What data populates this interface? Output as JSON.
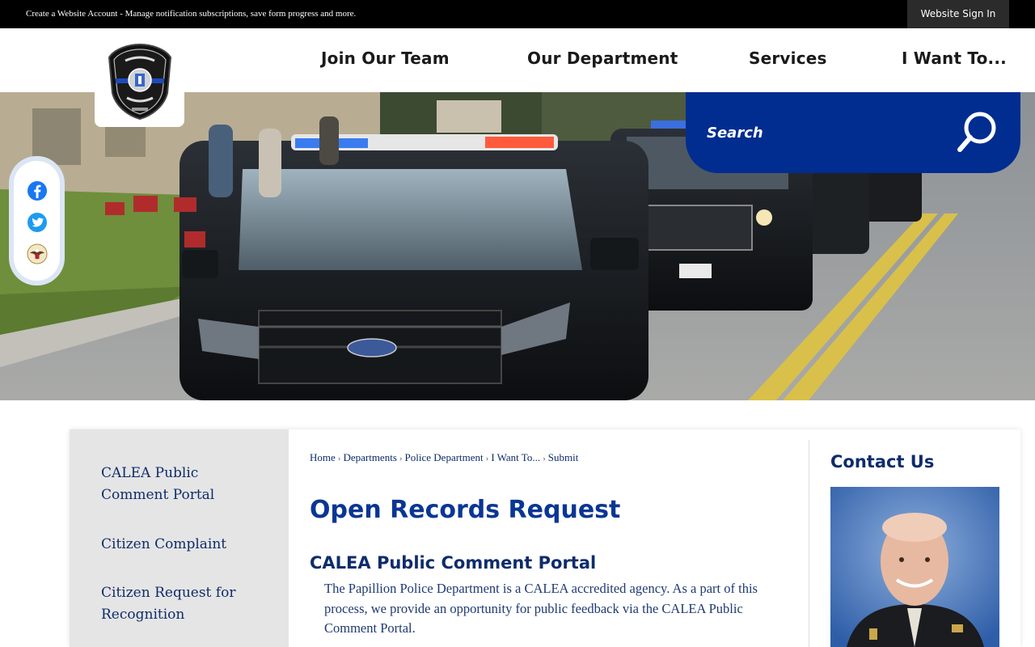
{
  "topbar": {
    "message": "Create a Website Account - Manage notification subscriptions, save form progress and more.",
    "sign_in": "Website Sign In"
  },
  "nav": {
    "items": [
      {
        "label": "Join Our Team"
      },
      {
        "label": "Our Department"
      },
      {
        "label": "Services"
      },
      {
        "label": "I Want To..."
      }
    ]
  },
  "logo": {
    "alt": "Papillion Police badge"
  },
  "search": {
    "placeholder": "Search",
    "icon": "search-icon"
  },
  "social": {
    "icons": [
      "facebook-icon",
      "twitter-icon",
      "bald-eagle-seal-icon"
    ]
  },
  "sidebar": {
    "items": [
      {
        "label": "CALEA Public Comment Portal"
      },
      {
        "label": "Citizen Complaint"
      },
      {
        "label": "Citizen Request for Recognition"
      }
    ]
  },
  "breadcrumb": {
    "items": [
      "Home",
      "Departments",
      "Police Department",
      "I Want To...",
      "Submit"
    ],
    "separator": "›"
  },
  "main": {
    "title": "Open Records Request",
    "section_title": "CALEA Public Comment Portal",
    "section_body": "The Papillion Police Department is a CALEA accredited agency. As a part of this process, we provide an opportunity for public feedback via the CALEA Public Comment Portal."
  },
  "contact": {
    "title": "Contact Us"
  },
  "colors": {
    "brand_blue": "#002d8f",
    "heading_blue": "#0a3694",
    "link_navy": "#0e2c6b",
    "topbar": "#000000",
    "sidebar_bg": "#e5e5e5"
  }
}
